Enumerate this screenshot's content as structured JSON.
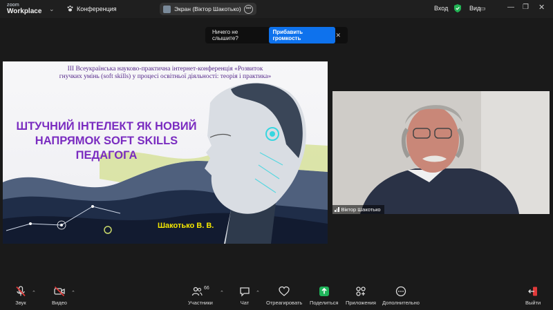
{
  "app": {
    "logo_top": "zoom",
    "logo_main": "Workplace"
  },
  "header": {
    "meeting_label": "Конференция",
    "screen_share_label": "Экран (Віктор Шакотько)",
    "login_label": "Вход",
    "view_label": "Вид"
  },
  "notification": {
    "text": "Ничего не слышите?",
    "button": "Прибавить громкость"
  },
  "slide": {
    "subtitle_line1": "ІІІ Всеукраїнська науково-практична інтернет-конференція «Розвиток",
    "subtitle_line2": "гнучких умінь (soft skills) у процесі освітньої діяльності: теорія і практика»",
    "title_line1": "ШТУЧНИЙ ІНТЕЛЕКТ ЯК НОВИЙ",
    "title_line2": "НАПРЯМОК SOFT SKILLS",
    "title_line3": "ПЕДАГОГА",
    "author": "Шакотько В. В."
  },
  "participant": {
    "name": "Віктор Шакотько"
  },
  "toolbar": {
    "audio": "Звук",
    "video": "Видео",
    "participants": "Участники",
    "participants_count": "66",
    "chat": "Чат",
    "react": "Отреагировать",
    "share": "Поделиться",
    "apps": "Приложения",
    "more": "Дополнительно",
    "leave": "Выйти"
  },
  "colors": {
    "accent": "#0e72ed",
    "title_purple": "#7a2cc0",
    "muted_red": "#e03a3a",
    "share_green": "#1fb45a"
  }
}
